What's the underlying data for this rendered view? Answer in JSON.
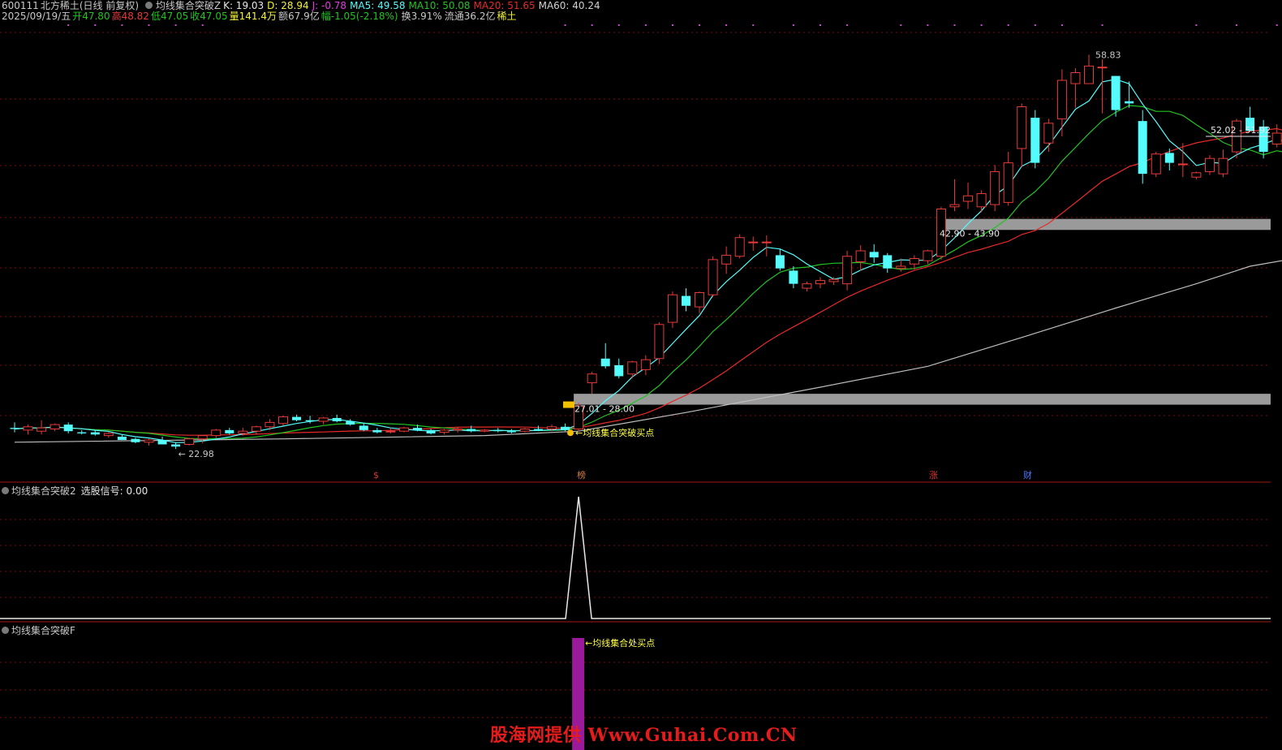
{
  "header": {
    "code": "600111",
    "name": "北方稀土",
    "period": "(日线 前复权)",
    "indicator": "均线集合突破Z",
    "k": "K: 19.03",
    "d": "D: 28.94",
    "j": "J: -0.78",
    "ma5": "MA5: 49.58",
    "ma10": "MA10: 50.08",
    "ma20": "MA20: 51.65",
    "ma60": "MA60: 40.24",
    "date": "2025/09/19/五",
    "open": "开47.80",
    "high": "高48.82",
    "low": "低47.05",
    "close": "收47.05",
    "vol": "量141.4万",
    "amount": "额67.9亿",
    "change": "幅-1.05(-2.18%)",
    "turnover": "换3.91%",
    "float": "流通36.2亿",
    "sector": "稀土"
  },
  "colors": {
    "up": "#e83a3a",
    "down": "#54fcfc",
    "ma5": "#54fcfc",
    "ma10": "#22c322",
    "ma20": "#e62a2a",
    "ma60": "#bdbdbd",
    "zone": "#9a9a9a",
    "signal": "#ffff4a",
    "purple": "#9a1a9a",
    "grid": "#7a0b0b",
    "border": "#a01616"
  },
  "chart_data": {
    "type": "candlestick",
    "annotations": {
      "high_label": "58.83",
      "low_label": "22.98",
      "zone_upper_label": "52.02 - 51.92",
      "zone_mid_label": "42.90 - 43.90",
      "zone_low_label": "27.01 - 28.00",
      "buy_label": "均线集合突破买点",
      "event_marks": [
        "$",
        "榜",
        "涨",
        "财"
      ]
    },
    "price_ylim": [
      21,
      61
    ],
    "zones": [
      {
        "low": 42.9,
        "high": 43.9,
        "start_index": 69
      },
      {
        "low": 27.01,
        "high": 28.0,
        "start_index": 42
      }
    ],
    "candles": [
      {
        "o": 24.9,
        "h": 25.4,
        "l": 24.5,
        "c": 24.8
      },
      {
        "o": 24.7,
        "h": 25.2,
        "l": 24.3,
        "c": 25.0
      },
      {
        "o": 24.6,
        "h": 25.6,
        "l": 24.3,
        "c": 24.9
      },
      {
        "o": 24.8,
        "h": 25.3,
        "l": 24.6,
        "c": 25.2
      },
      {
        "o": 25.2,
        "h": 25.4,
        "l": 24.4,
        "c": 24.6
      },
      {
        "o": 24.5,
        "h": 24.7,
        "l": 24.3,
        "c": 24.4
      },
      {
        "o": 24.5,
        "h": 24.7,
        "l": 24.2,
        "c": 24.3
      },
      {
        "o": 24.2,
        "h": 24.5,
        "l": 24.0,
        "c": 24.4
      },
      {
        "o": 24.1,
        "h": 24.3,
        "l": 23.8,
        "c": 23.8
      },
      {
        "o": 23.9,
        "h": 24.0,
        "l": 23.5,
        "c": 23.6
      },
      {
        "o": 23.6,
        "h": 23.9,
        "l": 23.3,
        "c": 23.8
      },
      {
        "o": 23.8,
        "h": 24.1,
        "l": 23.4,
        "c": 23.4
      },
      {
        "o": 23.4,
        "h": 23.6,
        "l": 22.98,
        "c": 23.2
      },
      {
        "o": 23.4,
        "h": 24.0,
        "l": 23.3,
        "c": 23.9
      },
      {
        "o": 23.9,
        "h": 24.2,
        "l": 23.5,
        "c": 24.2
      },
      {
        "o": 24.2,
        "h": 24.8,
        "l": 24.0,
        "c": 24.7
      },
      {
        "o": 24.7,
        "h": 24.9,
        "l": 24.3,
        "c": 24.4
      },
      {
        "o": 24.4,
        "h": 24.9,
        "l": 24.2,
        "c": 24.6
      },
      {
        "o": 24.6,
        "h": 25.1,
        "l": 24.3,
        "c": 25.0
      },
      {
        "o": 25.0,
        "h": 25.7,
        "l": 24.7,
        "c": 25.4
      },
      {
        "o": 25.3,
        "h": 26.0,
        "l": 25.1,
        "c": 25.9
      },
      {
        "o": 25.9,
        "h": 26.1,
        "l": 25.5,
        "c": 25.6
      },
      {
        "o": 25.6,
        "h": 26.0,
        "l": 25.3,
        "c": 25.5
      },
      {
        "o": 25.5,
        "h": 25.9,
        "l": 25.2,
        "c": 25.8
      },
      {
        "o": 25.8,
        "h": 26.1,
        "l": 25.4,
        "c": 25.5
      },
      {
        "o": 25.5,
        "h": 25.7,
        "l": 25.1,
        "c": 25.2
      },
      {
        "o": 25.1,
        "h": 25.3,
        "l": 24.6,
        "c": 24.7
      },
      {
        "o": 24.7,
        "h": 24.9,
        "l": 24.4,
        "c": 24.5
      },
      {
        "o": 24.6,
        "h": 24.9,
        "l": 24.4,
        "c": 24.6
      },
      {
        "o": 24.6,
        "h": 25.0,
        "l": 24.5,
        "c": 24.9
      },
      {
        "o": 24.9,
        "h": 25.2,
        "l": 24.6,
        "c": 24.7
      },
      {
        "o": 24.7,
        "h": 24.8,
        "l": 24.3,
        "c": 24.4
      },
      {
        "o": 24.5,
        "h": 24.8,
        "l": 24.3,
        "c": 24.7
      },
      {
        "o": 24.7,
        "h": 25.0,
        "l": 24.5,
        "c": 24.8
      },
      {
        "o": 24.8,
        "h": 25.1,
        "l": 24.5,
        "c": 24.6
      },
      {
        "o": 24.6,
        "h": 24.8,
        "l": 24.5,
        "c": 24.7
      },
      {
        "o": 24.7,
        "h": 24.9,
        "l": 24.5,
        "c": 24.6
      },
      {
        "o": 24.6,
        "h": 24.8,
        "l": 24.4,
        "c": 24.5
      },
      {
        "o": 24.6,
        "h": 24.9,
        "l": 24.5,
        "c": 24.8
      },
      {
        "o": 24.8,
        "h": 25.1,
        "l": 24.6,
        "c": 24.7
      },
      {
        "o": 24.8,
        "h": 25.2,
        "l": 24.6,
        "c": 25.0
      },
      {
        "o": 25.0,
        "h": 25.3,
        "l": 24.6,
        "c": 24.7
      },
      {
        "o": 24.8,
        "h": 27.2,
        "l": 24.6,
        "c": 26.9
      },
      {
        "o": 29.0,
        "h": 30.0,
        "l": 28.0,
        "c": 29.8
      },
      {
        "o": 31.2,
        "h": 32.6,
        "l": 30.3,
        "c": 30.5
      },
      {
        "o": 30.6,
        "h": 31.2,
        "l": 29.4,
        "c": 29.6
      },
      {
        "o": 29.8,
        "h": 31.0,
        "l": 29.4,
        "c": 30.9
      },
      {
        "o": 30.2,
        "h": 31.5,
        "l": 29.7,
        "c": 31.1
      },
      {
        "o": 31.2,
        "h": 34.5,
        "l": 30.7,
        "c": 34.3
      },
      {
        "o": 34.5,
        "h": 37.3,
        "l": 34.0,
        "c": 37.0
      },
      {
        "o": 36.9,
        "h": 37.6,
        "l": 35.5,
        "c": 36.0
      },
      {
        "o": 35.9,
        "h": 37.3,
        "l": 35.3,
        "c": 37.2
      },
      {
        "o": 37.0,
        "h": 40.5,
        "l": 36.8,
        "c": 40.2
      },
      {
        "o": 39.8,
        "h": 41.4,
        "l": 38.9,
        "c": 40.6
      },
      {
        "o": 40.5,
        "h": 42.5,
        "l": 40.3,
        "c": 42.2
      },
      {
        "o": 41.8,
        "h": 42.3,
        "l": 41.0,
        "c": 41.8
      },
      {
        "o": 41.8,
        "h": 42.4,
        "l": 40.5,
        "c": 41.8
      },
      {
        "o": 40.6,
        "h": 41.2,
        "l": 39.2,
        "c": 39.4
      },
      {
        "o": 39.2,
        "h": 39.6,
        "l": 37.6,
        "c": 38.0
      },
      {
        "o": 37.6,
        "h": 38.2,
        "l": 37.3,
        "c": 38.0
      },
      {
        "o": 38.0,
        "h": 38.6,
        "l": 37.6,
        "c": 38.3
      },
      {
        "o": 38.2,
        "h": 38.6,
        "l": 37.9,
        "c": 38.4
      },
      {
        "o": 38.0,
        "h": 41.0,
        "l": 37.4,
        "c": 40.5
      },
      {
        "o": 40.0,
        "h": 41.5,
        "l": 39.2,
        "c": 41.0
      },
      {
        "o": 40.9,
        "h": 41.6,
        "l": 39.9,
        "c": 40.4
      },
      {
        "o": 40.6,
        "h": 40.8,
        "l": 39.0,
        "c": 39.4
      },
      {
        "o": 39.4,
        "h": 40.3,
        "l": 39.1,
        "c": 39.6
      },
      {
        "o": 39.8,
        "h": 40.6,
        "l": 39.3,
        "c": 40.3
      },
      {
        "o": 40.1,
        "h": 41.1,
        "l": 39.8,
        "c": 41.0
      },
      {
        "o": 40.5,
        "h": 45.0,
        "l": 40.2,
        "c": 44.8
      },
      {
        "o": 45.0,
        "h": 47.5,
        "l": 44.6,
        "c": 45.2
      },
      {
        "o": 45.5,
        "h": 47.2,
        "l": 44.8,
        "c": 46.0
      },
      {
        "o": 45.0,
        "h": 46.5,
        "l": 44.5,
        "c": 46.2
      },
      {
        "o": 45.2,
        "h": 48.8,
        "l": 44.6,
        "c": 48.2
      },
      {
        "o": 45.4,
        "h": 50.0,
        "l": 45.1,
        "c": 49.0
      },
      {
        "o": 50.3,
        "h": 54.4,
        "l": 48.6,
        "c": 54.1
      },
      {
        "o": 53.1,
        "h": 53.8,
        "l": 48.5,
        "c": 49.0
      },
      {
        "o": 50.8,
        "h": 53.0,
        "l": 50.0,
        "c": 52.6
      },
      {
        "o": 53.0,
        "h": 57.5,
        "l": 51.4,
        "c": 56.5
      },
      {
        "o": 56.2,
        "h": 57.6,
        "l": 54.0,
        "c": 57.2
      },
      {
        "o": 56.2,
        "h": 58.83,
        "l": 56.2,
        "c": 57.8
      },
      {
        "o": 57.7,
        "h": 58.4,
        "l": 53.5,
        "c": 57.7
      },
      {
        "o": 56.9,
        "h": 56.9,
        "l": 53.2,
        "c": 53.8
      },
      {
        "o": 54.6,
        "h": 56.4,
        "l": 54.0,
        "c": 54.4
      },
      {
        "o": 52.8,
        "h": 53.8,
        "l": 47.1,
        "c": 48.0
      },
      {
        "o": 48.0,
        "h": 50.0,
        "l": 47.7,
        "c": 49.8
      },
      {
        "o": 49.9,
        "h": 50.3,
        "l": 48.3,
        "c": 49.0
      },
      {
        "o": 48.9,
        "h": 50.8,
        "l": 47.7,
        "c": 48.9
      },
      {
        "o": 47.7,
        "h": 48.2,
        "l": 47.5,
        "c": 48.1
      },
      {
        "o": 48.2,
        "h": 49.7,
        "l": 47.9,
        "c": 49.4
      },
      {
        "o": 48.0,
        "h": 50.2,
        "l": 47.7,
        "c": 49.4
      },
      {
        "o": 50.0,
        "h": 53.0,
        "l": 49.4,
        "c": 52.8
      },
      {
        "o": 53.1,
        "h": 54.1,
        "l": 51.9,
        "c": 51.9
      },
      {
        "o": 52.3,
        "h": 52.9,
        "l": 49.4,
        "c": 50.0
      },
      {
        "o": 50.7,
        "h": 52.5,
        "l": 50.4,
        "c": 51.7
      },
      {
        "o": 50.0,
        "h": 50.0,
        "l": 46.5,
        "c": 47.6
      },
      {
        "o": 47.8,
        "h": 48.82,
        "l": 47.05,
        "c": 47.05
      }
    ],
    "ma60_points": [
      [
        0,
        23.6
      ],
      [
        20,
        23.9
      ],
      [
        35,
        24.2
      ],
      [
        42,
        24.6
      ],
      [
        50,
        26.3
      ],
      [
        60,
        28.6
      ],
      [
        68,
        30.5
      ],
      [
        76,
        33.5
      ],
      [
        82,
        35.8
      ],
      [
        88,
        38.0
      ],
      [
        92,
        39.6
      ],
      [
        95,
        40.24
      ]
    ],
    "signal_spike_index": 42,
    "signal_value": "0.00",
    "bar_index": 42
  },
  "panel2": {
    "title": "均线集合突破2",
    "signal_label": "选股信号: 0.00"
  },
  "panel3": {
    "title": "均线集合突破F",
    "label": "←均线集合处买点"
  },
  "watermark": "股海网提供 Www.Guhai.Com.CN"
}
